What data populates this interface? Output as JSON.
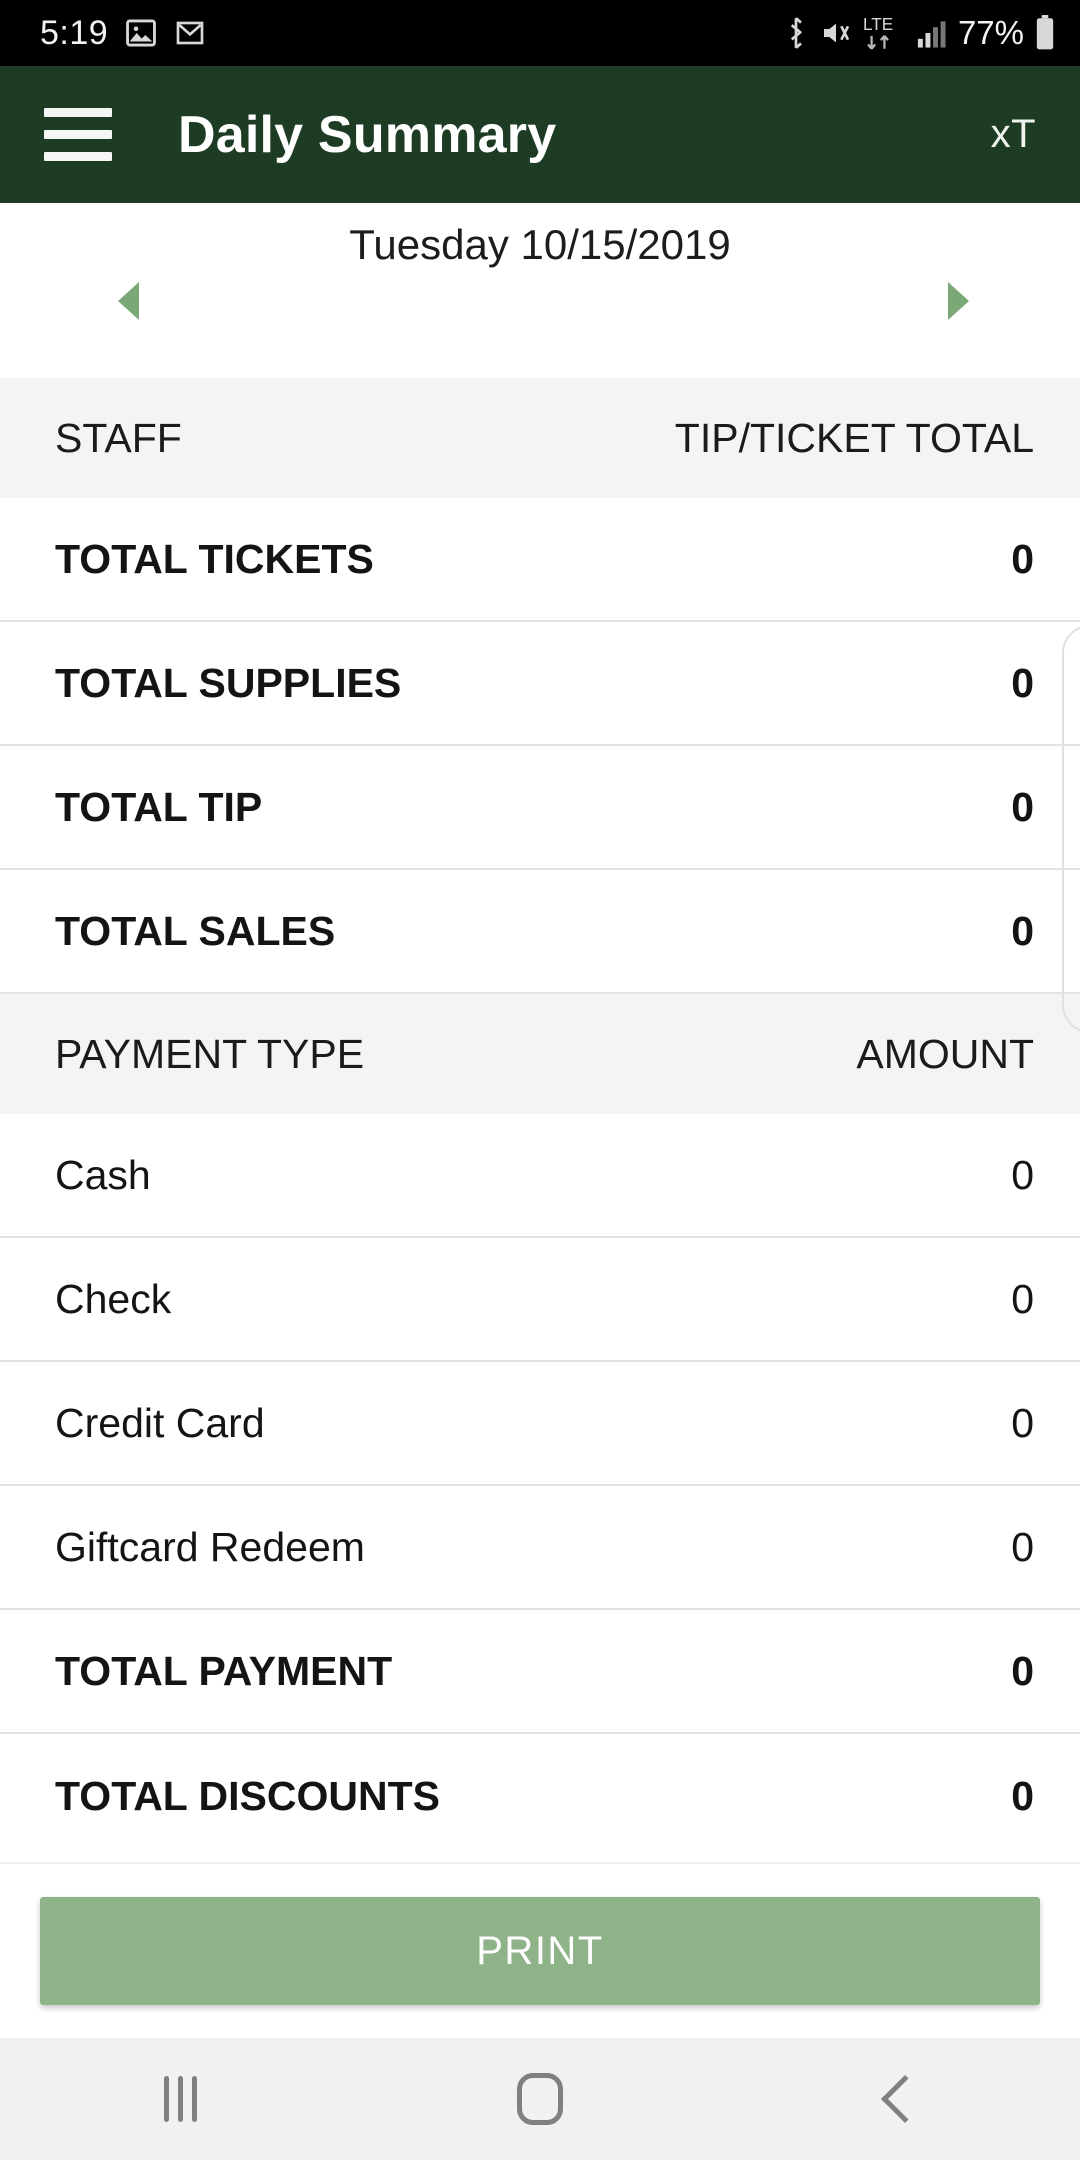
{
  "status_bar": {
    "time": "5:19",
    "left_icons": [
      "photo-icon",
      "gmail-icon"
    ],
    "right_icons": [
      "bluetooth-icon",
      "vibrate-mute-icon",
      "lte-icon",
      "signal-icon"
    ],
    "network": "LTE",
    "battery_percent": "77%"
  },
  "app_bar": {
    "menu_icon": "hamburger-menu-icon",
    "title": "Daily Summary",
    "action_label": "xT",
    "background_color": "#1e3c24"
  },
  "date_nav": {
    "date": "Tuesday 10/15/2019",
    "prev_icon": "previous-day-arrow-icon",
    "next_icon": "next-day-arrow-icon",
    "arrow_color": "#7aa877"
  },
  "staff_section": {
    "header": {
      "left": "STAFF",
      "right": "TIP/TICKET TOTAL"
    },
    "rows": [
      {
        "label": "TOTAL TICKETS",
        "value": "0",
        "bold": true
      },
      {
        "label": "TOTAL SUPPLIES",
        "value": "0",
        "bold": true
      },
      {
        "label": "TOTAL TIP",
        "value": "0",
        "bold": true
      },
      {
        "label": "TOTAL SALES",
        "value": "0",
        "bold": true
      }
    ]
  },
  "payment_section": {
    "header": {
      "left": "PAYMENT TYPE",
      "right": "AMOUNT"
    },
    "rows": [
      {
        "label": "Cash",
        "value": "0",
        "bold": false
      },
      {
        "label": "Check",
        "value": "0",
        "bold": false
      },
      {
        "label": "Credit Card",
        "value": "0",
        "bold": false
      },
      {
        "label": "Giftcard Redeem",
        "value": "0",
        "bold": false
      },
      {
        "label": "TOTAL PAYMENT",
        "value": "0",
        "bold": true
      },
      {
        "label": "TOTAL DISCOUNTS",
        "value": "0",
        "bold": true
      }
    ]
  },
  "footer": {
    "print_label": "PRINT",
    "print_color": "#8fb389"
  },
  "nav_bar": {
    "recents_icon": "recents-icon",
    "home_icon": "home-icon",
    "back_icon": "back-icon"
  }
}
